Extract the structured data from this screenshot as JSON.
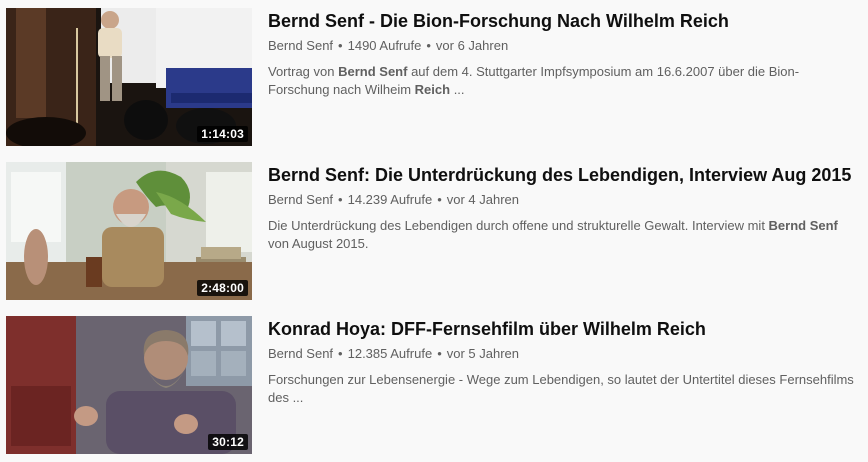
{
  "videos": [
    {
      "title": "Bernd Senf - Die Bion-Forschung Nach Wilhelm Reich",
      "channel": "Bernd Senf",
      "views": "1490 Aufrufe",
      "age": "vor 6 Jahren",
      "duration": "1:14:03",
      "description": {
        "p1": "Vortrag von ",
        "b1": "Bernd Senf",
        "p2": " auf dem 4. Stuttgarter Impfsymposium am 16.6.2007 über die Bion-Forschung nach Wilheim ",
        "b2": "Reich",
        "p3": " ..."
      }
    },
    {
      "title": "Bernd Senf: Die Unterdrückung des Lebendigen, Interview Aug 2015",
      "channel": "Bernd Senf",
      "views": "14.239 Aufrufe",
      "age": "vor 4 Jahren",
      "duration": "2:48:00",
      "description": {
        "p1": "Die Unterdrückung des Lebendigen durch offene und strukturelle Gewalt. Interview mit ",
        "b1": "Bernd Senf",
        "p2": " von August 2015."
      }
    },
    {
      "title": "Konrad Hoya: DFF-Fernsehfilm über Wilhelm Reich",
      "channel": "Bernd Senf",
      "views": "12.385 Aufrufe",
      "age": "vor 5 Jahren",
      "duration": "30:12",
      "description": {
        "p1": "Forschungen zur Lebensenergie - Wege zum Lebendigen, so lautet der Untertitel dieses Fernsehfilms des ..."
      }
    }
  ],
  "separator": "•"
}
